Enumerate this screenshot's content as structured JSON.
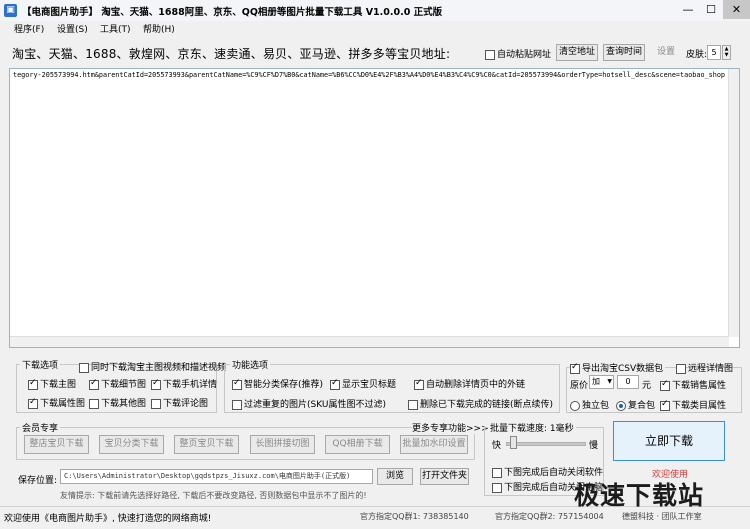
{
  "window": {
    "title": "【电商图片助手】 淘宝、天猫、1688阿里、京东、QQ相册等图片批量下载工具 V1.0.0.0 正式版",
    "minimize": "—",
    "maximize": "☐",
    "close": "✕"
  },
  "menu": [
    "程序(F)",
    "设置(S)",
    "工具(T)",
    "帮助(H)"
  ],
  "address_bar": {
    "label": "淘宝、天猫、1688、敦煌网、京东、速卖通、易贝、亚马逊、拼多多等宝贝地址:",
    "auto_paste": "自动粘贴网址",
    "clear_btn": "清空地址",
    "query_time_btn": "查询时间",
    "settings_btn": "设置",
    "skin_label": "皮肤:",
    "skin_value": "5"
  },
  "url_text": "tegory-205573994.htm&parentCatId=205573993&parentCatName=%C9%CF%D7%B0&catName=%B6%CC%D0%E4%2F%B3%A4%D0%E4%B3%C4%C9%C0&catId=205573994&orderType=hotsell_desc&scene=taobao_shop",
  "download_options": {
    "label": "下载选项",
    "also_download_video": "同时下载淘宝主图视频和描述视频",
    "items": [
      "下载主图",
      "下载细节图",
      "下载手机详情",
      "下载属性图",
      "下载其他图",
      "下载评论图"
    ]
  },
  "function_options": {
    "label": "功能选项",
    "smart_classify": "智能分类保存(推荐)",
    "show_title": "显示宝贝标题",
    "auto_remove_links": "自动删除详情页中的外链",
    "filter_duplicate": "过滤重复的图片(SKU属性图不过滤)",
    "delete_completed": "删除已下载完成的链接(断点续传)"
  },
  "csv_options": {
    "export_csv": "导出淘宝CSV数据包",
    "remote_detail": "远程详情图",
    "price_label": "原价",
    "price_op": "加",
    "price_value": "0",
    "price_unit": "元",
    "sales_attr": "下载销售属性",
    "independent": "独立包",
    "composite": "复合包",
    "category_attr": "下载类目属性"
  },
  "member": {
    "label": "会员专享",
    "more": "更多专享功能>>>",
    "buttons": [
      "整店宝贝下载",
      "宝贝分类下载",
      "整页宝贝下载",
      "长图拼接切图",
      "QQ相册下载",
      "批量加水印设置"
    ]
  },
  "speed": {
    "label": "批量下载速度: 1毫秒",
    "fast": "快",
    "slow": "慢",
    "speed_fraction": 0.05,
    "auto_close_software": "下图完成后自动关闭软件",
    "auto_shutdown": "下图完成后自动关闭电脑"
  },
  "download_btn": "立即下载",
  "welcome": "欢迎使用",
  "save": {
    "label": "保存位置:",
    "path": "C:\\Users\\Administrator\\Desktop\\gqdstpzs_Jisuxz.com\\电商图片助手(正式版)",
    "browse": "浏览",
    "open_folder": "打开文件夹",
    "tip": "友情提示: 下载前请先选择好路径, 下载后不要改变路径, 否则数据包中显示不了图片的!"
  },
  "status": {
    "left": "欢迎使用《电商图片助手》, 快速打造您的网络商城!",
    "qq1": "官方指定QQ群1: 738385140",
    "qq2": "官方指定QQ群2: 757154004",
    "right": "德盟科技 · 团队工作室"
  },
  "watermark": "极速下载站",
  "colors": {
    "accent_blue": "#3b8fd9",
    "welcome_red": "#d23a3a",
    "watermark": "#1c1c1c"
  }
}
